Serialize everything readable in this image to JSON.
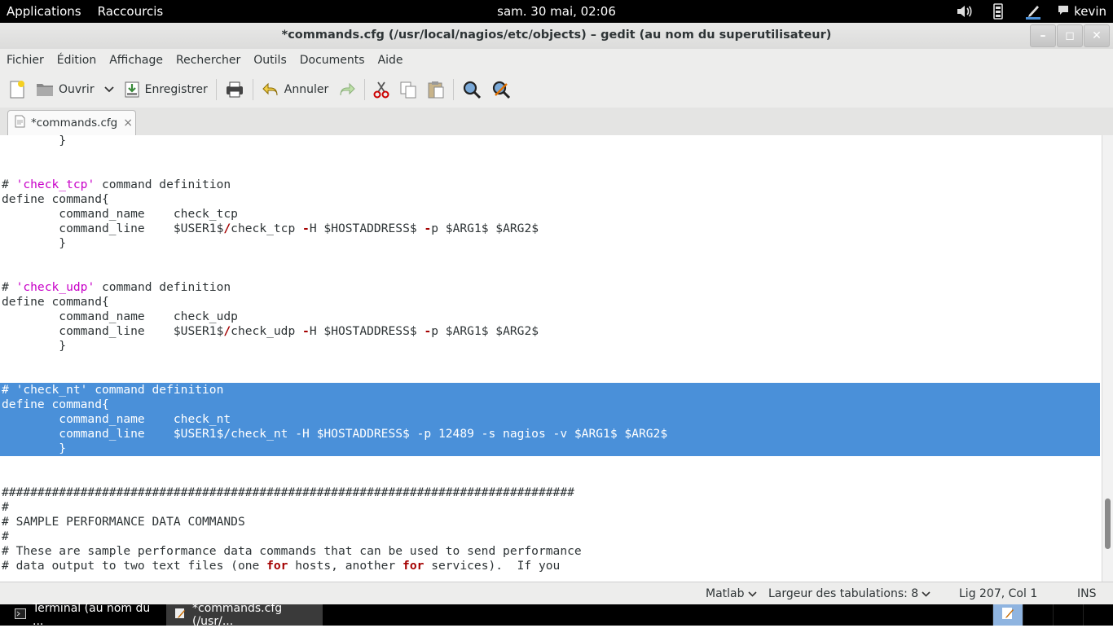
{
  "top_panel": {
    "applications": "Applications",
    "shortcuts": "Raccourcis",
    "clock": "sam. 30 mai, 02:06",
    "user": "kevin",
    "icons": [
      "volume-icon",
      "network-icon",
      "pen-icon",
      "chat-icon"
    ]
  },
  "window": {
    "title": "*commands.cfg (/usr/local/nagios/etc/objects) – gedit (au nom du superutilisateur)",
    "minimize": "–",
    "maximize": "◻",
    "close": "✕"
  },
  "menubar": [
    "Fichier",
    "Édition",
    "Affichage",
    "Rechercher",
    "Outils",
    "Documents",
    "Aide"
  ],
  "toolbar": {
    "open": "Ouvrir",
    "save": "Enregistrer",
    "undo": "Annuler"
  },
  "tab": {
    "label": "*commands.cfg",
    "close": "×"
  },
  "editor": {
    "lines": [
      "        }",
      "",
      "",
      "# 'check_tcp' command definition",
      "define command{",
      "        command_name    check_tcp",
      "        command_line    $USER1$/check_tcp -H $HOSTADDRESS$ -p $ARG1$ $ARG2$",
      "        }",
      "",
      "",
      "# 'check_udp' command definition",
      "define command{",
      "        command_name    check_udp",
      "        command_line    $USER1$/check_udp -H $HOSTADDRESS$ -p $ARG1$ $ARG2$",
      "        }",
      "",
      "",
      "# 'check_nt' command definition",
      "define command{",
      "        command_name    check_nt",
      "        command_line    $USER1$/check_nt -H $HOSTADDRESS$ -p 12489 -s nagios -v $ARG1$ $ARG2$",
      "        }",
      "",
      "",
      "################################################################################",
      "#",
      "# SAMPLE PERFORMANCE DATA COMMANDS",
      "#",
      "# These are sample performance data commands that can be used to send performance",
      "# data output to two text files (one for hosts, another for services).  If you"
    ],
    "selection_start": 17,
    "selection_end": 21,
    "scroll_position": 0.93
  },
  "statusbar": {
    "language": "Matlab",
    "tab_width": "Largeur des tabulations:  8",
    "position": "Lig 207, Col 1",
    "mode": "INS"
  },
  "taskbar": {
    "tasks": [
      "Terminal (au nom du ...",
      "*commands.cfg (/usr/..."
    ]
  }
}
